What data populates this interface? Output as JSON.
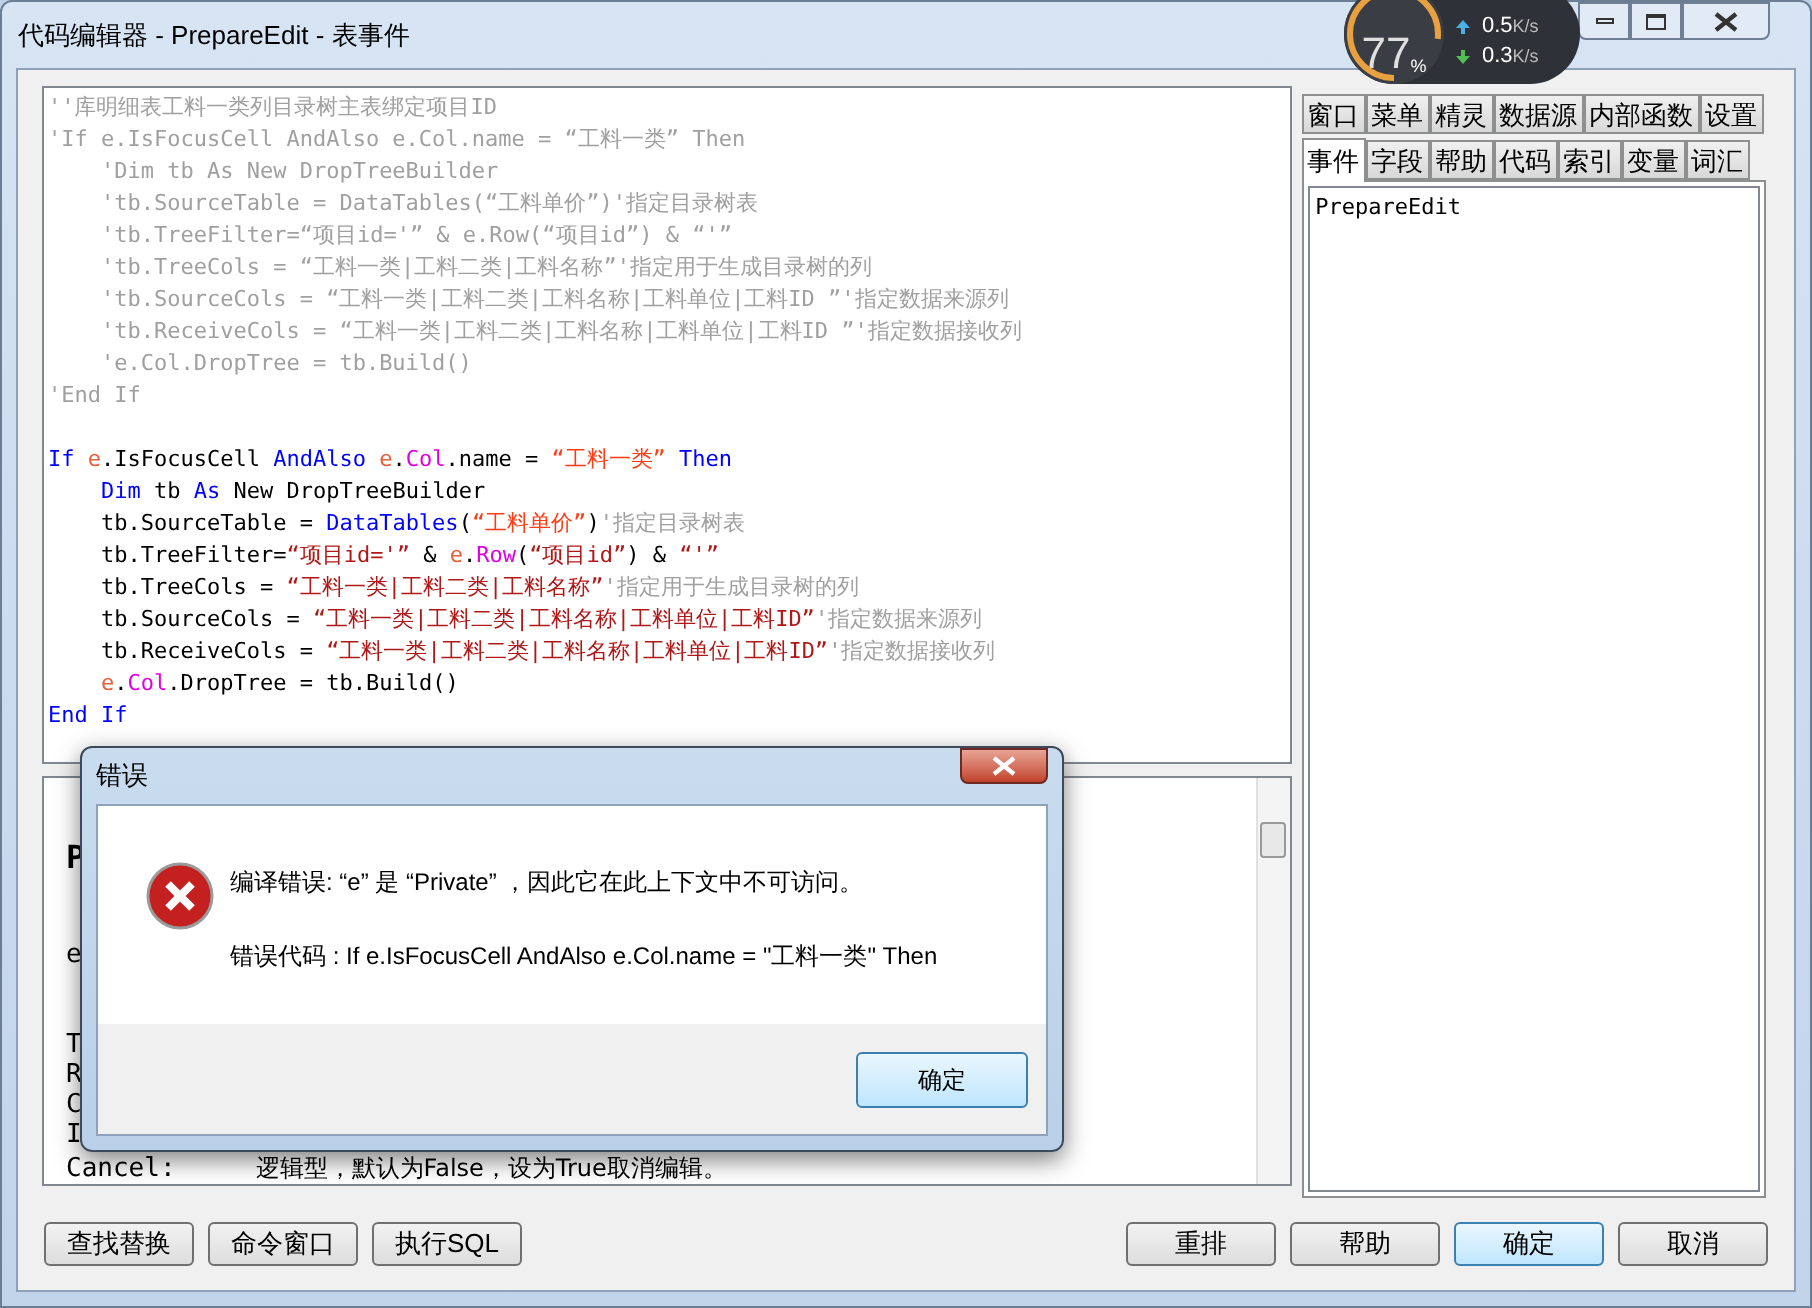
{
  "window": {
    "title": "代码编辑器 - PrepareEdit - 表事件"
  },
  "overlay_widget": {
    "percent": "77",
    "percent_sign": "%",
    "upload": "0.5",
    "upload_unit": "K/s",
    "download": "0.3",
    "download_unit": "K/s"
  },
  "code_lines": [
    [
      {
        "text": "''库明细表工料一类列目录树主表绑定项目ID",
        "kind": "cmt"
      }
    ],
    [
      {
        "text": "'If e.IsFocusCell AndAlso e.Col.name = “工料一类” Then",
        "kind": "cmt"
      }
    ],
    [
      {
        "text": "    'Dim tb As New DropTreeBuilder",
        "kind": "cmt"
      }
    ],
    [
      {
        "text": "    'tb.SourceTable = DataTables(“工料单价”)'指定目录树表",
        "kind": "cmt"
      }
    ],
    [
      {
        "text": "    'tb.TreeFilter=“项目id='” & e.Row(“项目id”) & “'”",
        "kind": "cmt"
      }
    ],
    [
      {
        "text": "    'tb.TreeCols = “工料一类|工料二类|工料名称”'指定用于生成目录树的列",
        "kind": "cmt"
      }
    ],
    [
      {
        "text": "    'tb.SourceCols = “工料一类|工料二类|工料名称|工料单位|工料ID ”'指定数据来源列",
        "kind": "cmt"
      }
    ],
    [
      {
        "text": "    'tb.ReceiveCols = “工料一类|工料二类|工料名称|工料单位|工料ID ”'指定数据接收列",
        "kind": "cmt"
      }
    ],
    [
      {
        "text": "    'e.Col.DropTree = tb.Build()",
        "kind": "cmt"
      }
    ],
    [
      {
        "text": "'End If",
        "kind": "cmt"
      }
    ],
    [
      {
        "text": "If",
        "kind": "kw"
      },
      {
        "text": " e",
        "kind": "obj"
      },
      {
        "text": ".IsFocusCell ",
        "kind": "plain"
      },
      {
        "text": "AndAlso",
        "kind": "kw"
      },
      {
        "text": " e",
        "kind": "obj"
      },
      {
        "text": ".",
        "kind": "plain"
      },
      {
        "text": "Col",
        "kind": "member"
      },
      {
        "text": ".name = ",
        "kind": "plain"
      },
      {
        "text": "“工料一类”",
        "kind": "str"
      },
      {
        "text": " Then",
        "kind": "kw"
      }
    ],
    [
      {
        "text": "    Dim",
        "kind": "kw"
      },
      {
        "text": " tb ",
        "kind": "plain"
      },
      {
        "text": "As",
        "kind": "kw"
      },
      {
        "text": " New DropTreeBuilder",
        "kind": "plain"
      }
    ],
    [
      {
        "text": "    tb.SourceTable = ",
        "kind": "plain"
      },
      {
        "text": "DataTables",
        "kind": "kw"
      },
      {
        "text": "(",
        "kind": "plain"
      },
      {
        "text": "“工料单价”",
        "kind": "str"
      },
      {
        "text": ")",
        "kind": "plain"
      },
      {
        "text": "'指定目录树表",
        "kind": "cmt"
      }
    ],
    [
      {
        "text": "    tb.TreeFilter=",
        "kind": "plain"
      },
      {
        "text": "“项目id='”",
        "kind": "str2"
      },
      {
        "text": " & ",
        "kind": "plain"
      },
      {
        "text": "e",
        "kind": "obj"
      },
      {
        "text": ".",
        "kind": "plain"
      },
      {
        "text": "Row",
        "kind": "member"
      },
      {
        "text": "(",
        "kind": "plain"
      },
      {
        "text": "“项目id”",
        "kind": "str2"
      },
      {
        "text": ") & ",
        "kind": "plain"
      },
      {
        "text": "“'”",
        "kind": "str2"
      }
    ],
    [
      {
        "text": "    tb.TreeCols = ",
        "kind": "plain"
      },
      {
        "text": "“工料一类|工料二类|工料名称”",
        "kind": "str2"
      },
      {
        "text": "'指定用于生成目录树的列",
        "kind": "cmt"
      }
    ],
    [
      {
        "text": "    tb.SourceCols = ",
        "kind": "plain"
      },
      {
        "text": "“工料一类|工料二类|工料名称|工料单位|工料ID”",
        "kind": "str2"
      },
      {
        "text": "'指定数据来源列",
        "kind": "cmt"
      }
    ],
    [
      {
        "text": "    tb.ReceiveCols = ",
        "kind": "plain"
      },
      {
        "text": "“工料一类|工料二类|工料名称|工料单位|工料ID”",
        "kind": "str2"
      },
      {
        "text": "'指定数据接收列",
        "kind": "cmt"
      }
    ],
    [
      {
        "text": "    e",
        "kind": "obj"
      },
      {
        "text": ".",
        "kind": "plain"
      },
      {
        "text": "Col",
        "kind": "member"
      },
      {
        "text": ".DropTree = tb.Build()",
        "kind": "plain"
      }
    ],
    [
      {
        "text": "End If",
        "kind": "kw"
      }
    ]
  ],
  "help_panel": {
    "heading": "P",
    "lines": [
      "e",
      "T",
      "R",
      "C",
      "I"
    ],
    "last_line": {
      "term": "Cancel:",
      "description": "逻辑型，默认为False，设为True取消编辑。"
    }
  },
  "tabs_row_1": [
    {
      "label": "窗口",
      "selected": false
    },
    {
      "label": "菜单",
      "selected": false
    },
    {
      "label": "精灵",
      "selected": false
    },
    {
      "label": "数据源",
      "selected": false
    },
    {
      "label": "内部函数",
      "selected": false
    },
    {
      "label": "设置",
      "selected": false
    }
  ],
  "tabs_row_2": [
    {
      "label": "事件",
      "selected": true
    },
    {
      "label": "字段",
      "selected": false
    },
    {
      "label": "帮助",
      "selected": false
    },
    {
      "label": "代码",
      "selected": false
    },
    {
      "label": "索引",
      "selected": false
    },
    {
      "label": "变量",
      "selected": false
    },
    {
      "label": "词汇",
      "selected": false
    }
  ],
  "event_list": [
    {
      "label": "PrepareEdit",
      "selected": false
    }
  ],
  "left_buttons": [
    {
      "label": "查找替换",
      "focused": false
    },
    {
      "label": "命令窗口",
      "focused": false
    },
    {
      "label": "执行SQL",
      "focused": false
    }
  ],
  "right_buttons": [
    {
      "label": "重排",
      "focused": false
    },
    {
      "label": "帮助",
      "focused": false
    },
    {
      "label": "确定",
      "focused": true
    },
    {
      "label": "取消",
      "focused": false
    }
  ],
  "dialog": {
    "title": "错误",
    "message": "编译错误: “e” 是 “Private” ，因此它在此上下文中不可访问。",
    "code": "错误代码 : If e.IsFocusCell AndAlso e.Col.name = \"工料一类\" Then",
    "button": {
      "label": "确定",
      "focused": true
    }
  }
}
